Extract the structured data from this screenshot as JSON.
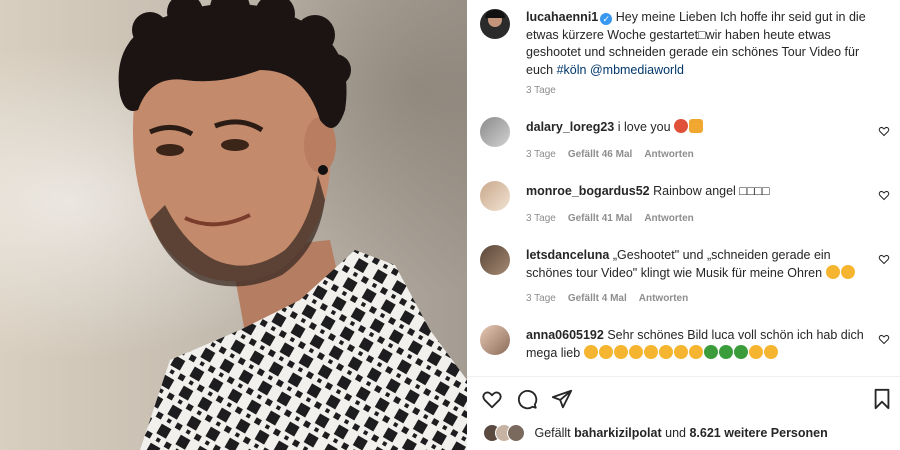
{
  "post": {
    "username": "lucahaenni1",
    "caption": "Hey meine Lieben Ich hoffe ihr seid gut in die etwas kürzere Woche gestartet□wir haben heute etwas geshootet und schneiden gerade ein schönes Tour Video für euch ",
    "hashtag": "#köln",
    "mention": "@mbmediaworld",
    "time": "3 Tage"
  },
  "comments": [
    {
      "username": "dalary_loreg23",
      "text": "i love you",
      "time": "3 Tage",
      "likes": "Gefällt 46 Mal",
      "reply": "Antworten",
      "emojis": [
        "#e0513a",
        "#f0a830"
      ]
    },
    {
      "username": "monroe_bogardus52",
      "text": "Rainbow angel □□□□",
      "time": "3 Tage",
      "likes": "Gefällt 41 Mal",
      "reply": "Antworten",
      "emojis": []
    },
    {
      "username": "letsdanceluna",
      "text": "„Geshootet\" und „schneiden gerade ein schönes tour Video\" klingt wie Musik für meine Ohren ",
      "time": "3 Tage",
      "likes": "Gefällt 4 Mal",
      "reply": "Antworten",
      "emojis": [
        "#f5b531",
        "#f5b531"
      ]
    },
    {
      "username": "anna0605192",
      "text": "Sehr schönes Bild luca voll schön ich hab dich mega lieb ",
      "time": "",
      "likes": "",
      "reply": "",
      "emojis": [
        "#f5b531",
        "#f5b531",
        "#f5b531",
        "#f5b531",
        "#f5b531",
        "#f5b531",
        "#f5b531",
        "#f5b531",
        "#3a9c3a",
        "#3a9c3a",
        "#3a9c3a",
        "#f5b531",
        "#f5b531"
      ]
    }
  ],
  "likes_bar": {
    "prefix": "Gefällt",
    "user": "baharkizilpolat",
    "middle": "und",
    "count": "8.621 weitere Personen"
  },
  "icons": [
    "heart-icon",
    "comment-icon",
    "share-icon",
    "bookmark-icon"
  ],
  "colors": {
    "link": "#00376b",
    "meta": "#8e8e8e",
    "verified": "#3897f0"
  }
}
